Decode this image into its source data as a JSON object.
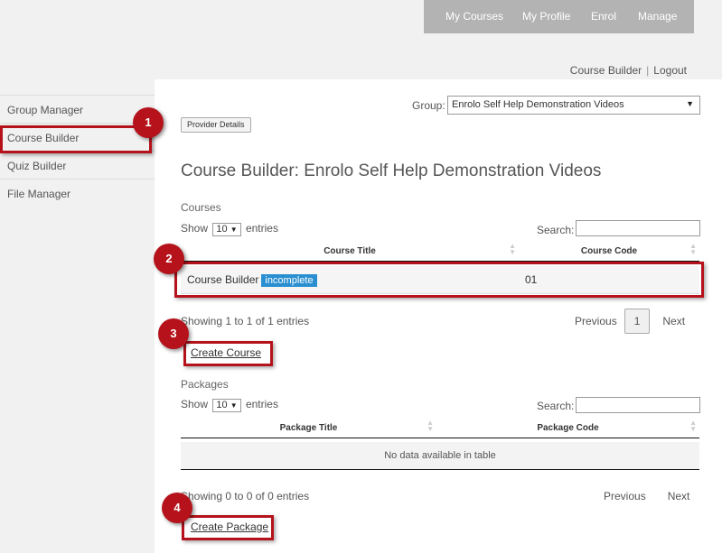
{
  "topnav": {
    "items": [
      "My Courses",
      "My Profile",
      "Enrol",
      "Manage"
    ]
  },
  "userbar": {
    "link": "Course Builder",
    "separator": "|",
    "logout": "Logout"
  },
  "sidebar": {
    "items": [
      "Group Manager",
      "Course Builder",
      "Quiz Builder",
      "File Manager"
    ]
  },
  "group": {
    "label": "Group:",
    "value": "Enrolo Self Help Demonstration Videos",
    "arrow": "▼"
  },
  "provider_button": "Provider Details",
  "page_title": "Course Builder: Enrolo Self Help Demonstration Videos",
  "courses": {
    "section_label": "Courses",
    "show": "Show",
    "entries_select": "10",
    "entries": "entries",
    "search_label": "Search:",
    "columns": [
      "Course Title",
      "Course Code"
    ],
    "rows": [
      {
        "title": "Course Builder",
        "badge": "incomplete",
        "code": "01"
      }
    ],
    "info": "Showing 1 to 1 of 1 entries",
    "previous": "Previous",
    "page": "1",
    "next": "Next",
    "create_link": "Create Course"
  },
  "packages": {
    "section_label": "Packages",
    "show": "Show",
    "entries_select": "10",
    "entries": "entries",
    "search_label": "Search:",
    "columns": [
      "Package Title",
      "Package Code"
    ],
    "empty": "No data available in table",
    "info": "Showing 0 to 0 of 0 entries",
    "previous": "Previous",
    "next": "Next",
    "create_link": "Create Package"
  },
  "callouts": [
    "1",
    "2",
    "3",
    "4"
  ],
  "colors": {
    "callout_red": "#b5121b",
    "badge_blue": "#2a8fd0",
    "nav_gray": "#b3b3b3"
  }
}
